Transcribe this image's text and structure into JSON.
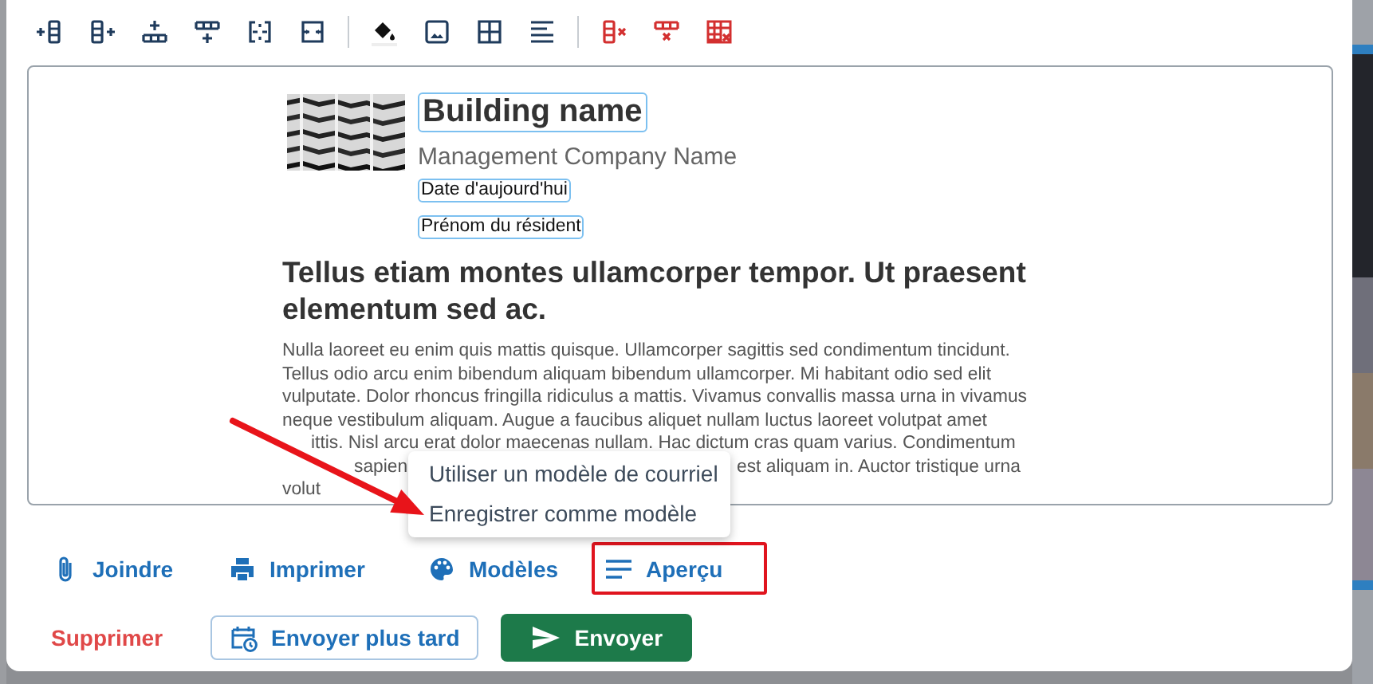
{
  "editor": {
    "building_name": "Building name",
    "company": "Management Company Name",
    "merge_fields": [
      "Date d'aujourd'hui",
      "Prénom du résident"
    ],
    "heading": "Tellus etiam montes ullamcorper tempor. Ut praesent elementum sed ac.",
    "paragraph_lines": [
      [
        "Nulla laoreet eu enim quis mattis quisque. Ullamcorper sagittis sed condimentum tincidunt."
      ],
      [
        "Tellus odio arcu enim bibendum aliquam bibendum ullamcorper. Mi habitant odio sed elit"
      ],
      [
        "vulputate. Dolor rhoncus fringilla ridiculus a mattis. Vivamus convallis massa urna in vivamus"
      ],
      [
        "neque vestibulum aliquam. Augue a faucibus aliquet nullam luctus laoreet volutpat amet"
      ],
      [
        "ittis. Nisl arcu erat dolor maecenas nullam. Hac dictum cras quam varius. Condimentum"
      ],
      [
        "sapien",
        "est aliquam in. Auctor tristique urna"
      ],
      [
        "volut"
      ]
    ]
  },
  "template_menu": [
    "Utiliser un modèle de courriel",
    "Enregistrer comme modèle"
  ],
  "actions": [
    {
      "label": "Joindre",
      "highlighted": false
    },
    {
      "label": "Imprimer",
      "highlighted": false
    },
    {
      "label": "Modèles",
      "highlighted": false
    },
    {
      "label": "Aperçu",
      "highlighted": true
    }
  ],
  "footer": {
    "delete": "Supprimer",
    "send_later": "Envoyer plus tard",
    "send": "Envoyer"
  }
}
